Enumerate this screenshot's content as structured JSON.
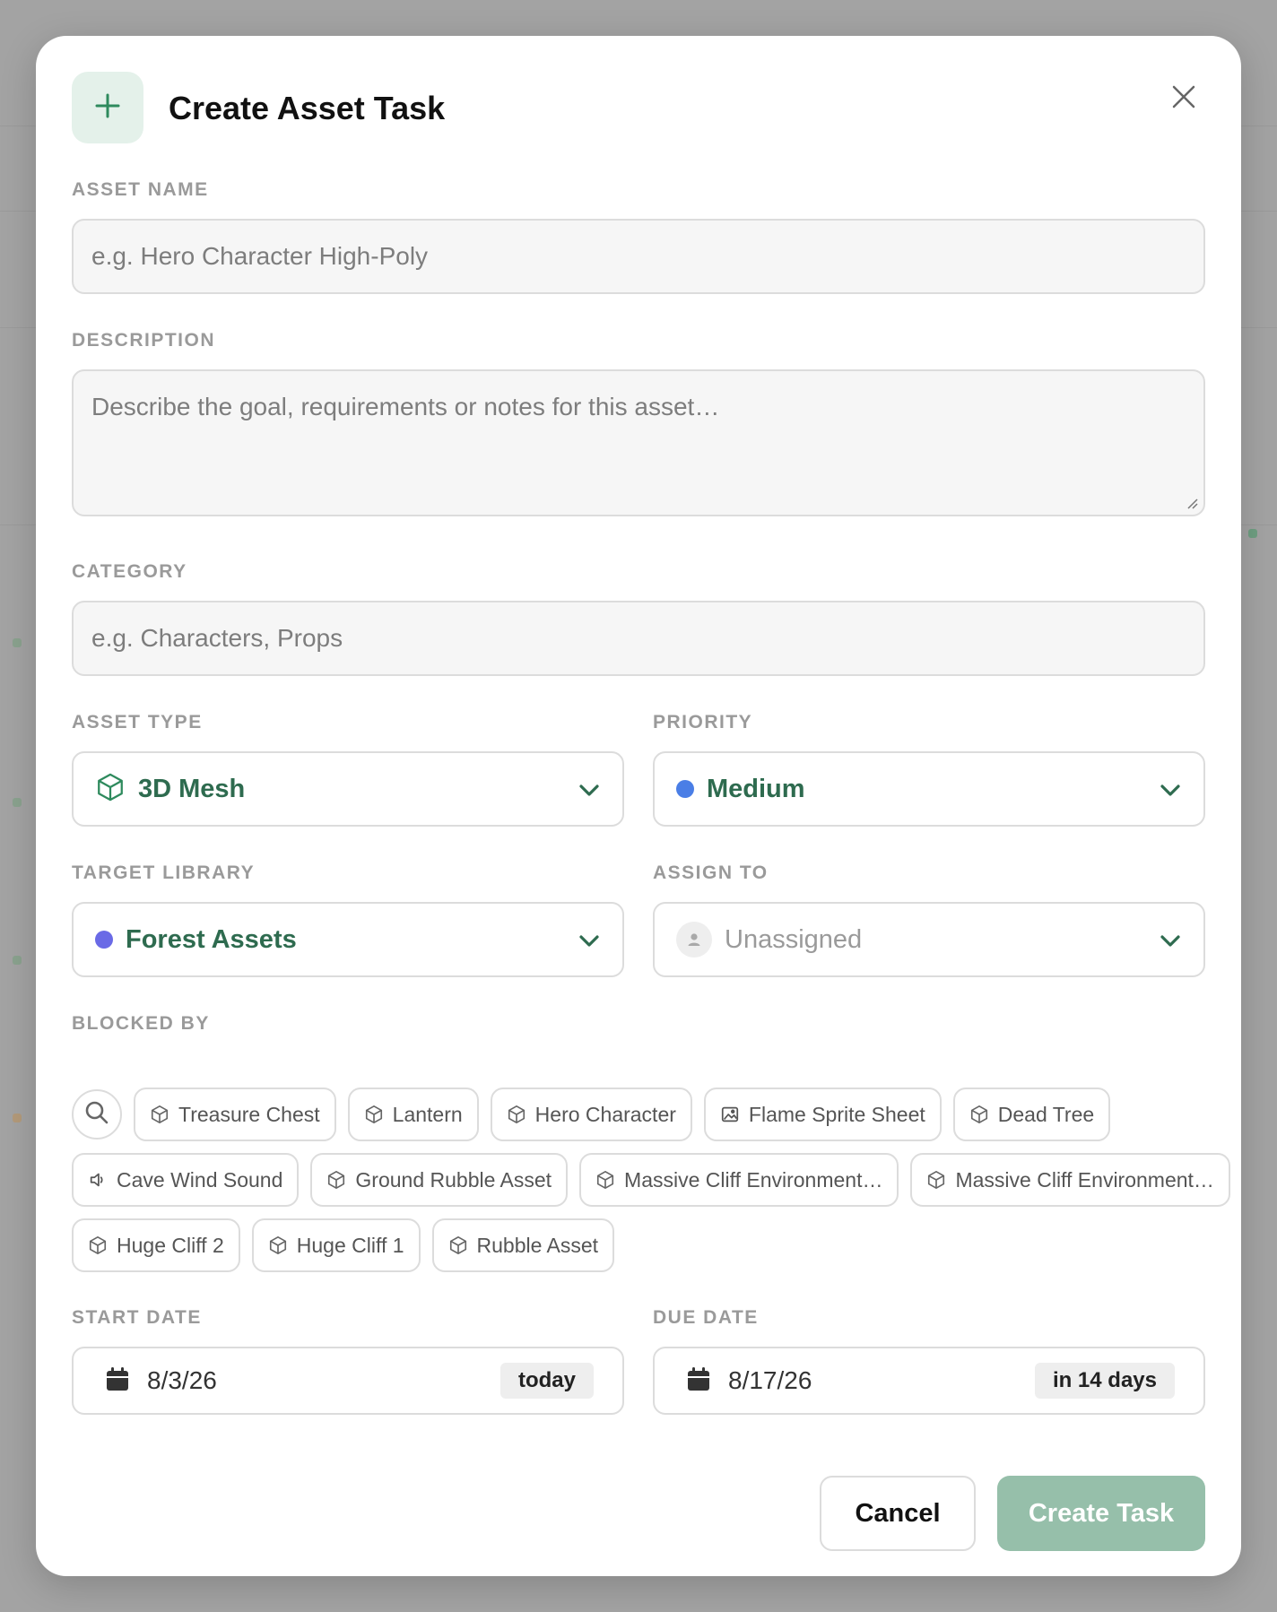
{
  "dialog": {
    "title": "Create Asset Task",
    "close_label": "×",
    "accent_color": "#2e8a5d",
    "badge_bg": "#e4f1ea"
  },
  "fields": {
    "asset_name": {
      "label": "ASSET NAME",
      "value": "",
      "placeholder": "e.g. Hero Character High-Poly"
    },
    "description": {
      "label": "DESCRIPTION",
      "value": "",
      "placeholder": "Describe the goal, requirements or notes for this asset…"
    },
    "category": {
      "label": "CATEGORY",
      "value": "",
      "placeholder": "e.g. Characters, Props"
    },
    "asset_type": {
      "label": "ASSET TYPE",
      "value": "3D Mesh",
      "icon": "cube-icon"
    },
    "priority": {
      "label": "PRIORITY",
      "value": "Medium",
      "dot_color": "#4a7ee6"
    },
    "target_library": {
      "label": "TARGET LIBRARY",
      "value": "Forest Assets",
      "dot_color": "#6a6ae6"
    },
    "assign_to": {
      "label": "ASSIGN TO",
      "value": "Unassigned",
      "icon": "user-icon"
    }
  },
  "blocked_by": {
    "label": "BLOCKED BY",
    "search_icon": "search-icon",
    "chips": [
      {
        "label": "Treasure Chest",
        "icon": "cube-icon"
      },
      {
        "label": "Lantern",
        "icon": "cube-icon"
      },
      {
        "label": "Hero Character",
        "icon": "cube-icon"
      },
      {
        "label": "Flame Sprite Sheet",
        "icon": "image-icon"
      },
      {
        "label": "Dead Tree",
        "icon": "cube-icon"
      },
      {
        "label": "Cave Wind Sound",
        "icon": "speaker-icon"
      },
      {
        "label": "Ground Rubble Asset",
        "icon": "cube-icon"
      },
      {
        "label": "Massive Cliff Environment…",
        "icon": "cube-icon"
      },
      {
        "label": "Massive Cliff Environment…",
        "icon": "cube-icon"
      },
      {
        "label": "Huge Cliff 2",
        "icon": "cube-icon"
      },
      {
        "label": "Huge Cliff 1",
        "icon": "cube-icon"
      },
      {
        "label": "Rubble Asset",
        "icon": "cube-icon"
      }
    ]
  },
  "dates": {
    "start": {
      "label": "START DATE",
      "value": "8/3/26",
      "relative": "today",
      "icon": "calendar-icon"
    },
    "due": {
      "label": "DUE DATE",
      "value": "8/17/26",
      "relative": "in 14 days",
      "icon": "calendar-icon"
    }
  },
  "actions": {
    "cancel_label": "Cancel",
    "create_label": "Create Task",
    "create_bg": "#96bfaa"
  }
}
